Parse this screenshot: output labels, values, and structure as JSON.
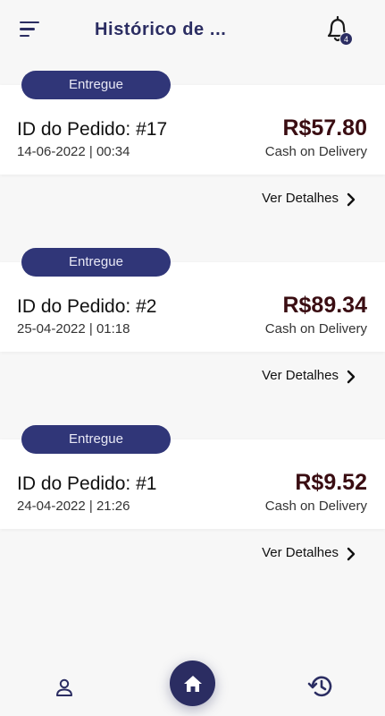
{
  "header": {
    "title": "Histórico de ...",
    "notification_count": "4"
  },
  "orders": [
    {
      "status": "Entregue",
      "id_label": "ID do Pedido: #17",
      "datetime": "14-06-2022 | 00:34",
      "price": "R$57.80",
      "payment": "Cash on Delivery",
      "details_label": "Ver Detalhes"
    },
    {
      "status": "Entregue",
      "id_label": "ID do Pedido: #2",
      "datetime": "25-04-2022 | 01:18",
      "price": "R$89.34",
      "payment": "Cash on Delivery",
      "details_label": "Ver Detalhes"
    },
    {
      "status": "Entregue",
      "id_label": "ID do Pedido: #1",
      "datetime": "24-04-2022 | 21:26",
      "price": "R$9.52",
      "payment": "Cash on Delivery",
      "details_label": "Ver Detalhes"
    }
  ],
  "icons": {
    "menu": "menu-icon",
    "notification": "bell-icon",
    "details": "chevron-right-icon",
    "profile": "user-icon",
    "home": "home-icon",
    "history": "history-icon"
  },
  "colors": {
    "primary": "#2b2d62",
    "pill": "#303678",
    "price": "#3a0d12",
    "background": "#f7f7f7"
  }
}
